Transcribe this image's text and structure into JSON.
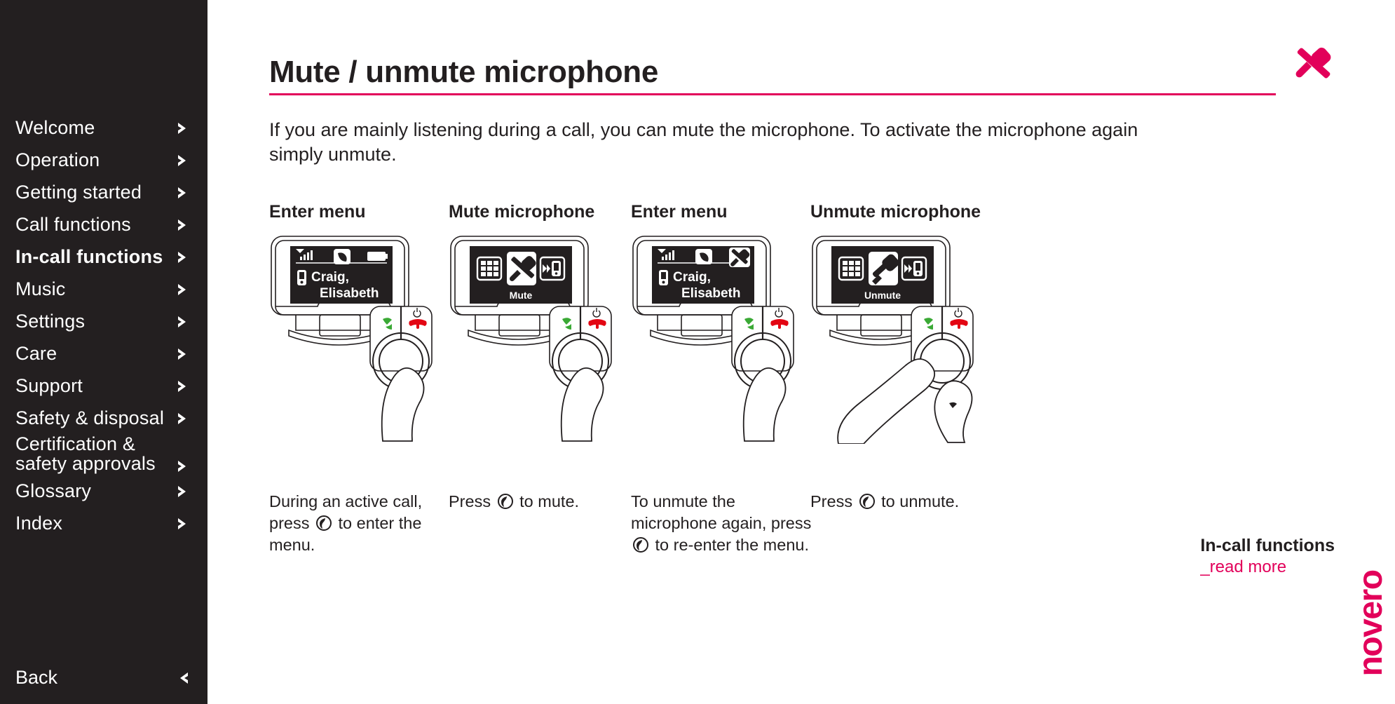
{
  "sidebar": {
    "items": [
      {
        "label": "Welcome",
        "active": false,
        "icon": "chevron-right-icon"
      },
      {
        "label": "Operation",
        "active": false,
        "icon": "chevron-right-icon"
      },
      {
        "label": "Getting started",
        "active": false,
        "icon": "chevron-right-icon"
      },
      {
        "label": "Call functions",
        "active": false,
        "icon": "chevron-right-icon"
      },
      {
        "label": "In-call functions",
        "active": true,
        "icon": "chevron-right-icon"
      },
      {
        "label": "Music",
        "active": false,
        "icon": "chevron-right-icon"
      },
      {
        "label": "Settings",
        "active": false,
        "icon": "chevron-right-icon"
      },
      {
        "label": "Care",
        "active": false,
        "icon": "chevron-right-icon"
      },
      {
        "label": "Support",
        "active": false,
        "icon": "chevron-right-icon"
      },
      {
        "label": "Safety & disposal",
        "active": false,
        "icon": "chevron-right-icon"
      },
      {
        "label": "Certification &\nsafety approvals",
        "active": false,
        "icon": "chevron-right-icon"
      },
      {
        "label": "Glossary",
        "active": false,
        "icon": "chevron-right-icon"
      },
      {
        "label": "Index",
        "active": false,
        "icon": "chevron-right-icon"
      }
    ],
    "back_label": "Back",
    "back_icon": "chevron-left-icon",
    "background_color": "#231f20"
  },
  "header": {
    "title": "Mute / unmute microphone",
    "rule_color": "#e2005a",
    "icon": "muted-microphone-icon",
    "icon_color": "#e2005a"
  },
  "intro": "If you are mainly listening during a call, you can mute the microphone. To activate the microphone again simply unmute.",
  "steps": [
    {
      "title": "Enter menu",
      "screen_type": "call-in-progress",
      "screen": {
        "signal_icon": "signal-bars-icon",
        "call_icon": "handset-icon",
        "status_right_icon": "battery-full-icon",
        "contact_icon": "mobile-phone-icon",
        "contact_line1": "Craig,",
        "contact_line2": "Elisabeth"
      },
      "caption_before": "During an active call, press",
      "caption_glyph": "nav-dial-button-icon",
      "caption_after": "to enter the menu."
    },
    {
      "title": "Mute microphone",
      "screen_type": "menu",
      "screen": {
        "left_icon": "keypad-icon",
        "center_icon": "muted-microphone-icon",
        "right_icon": "transfer-to-phone-icon",
        "menu_label": "Mute"
      },
      "caption_before": "Press",
      "caption_glyph": "nav-dial-button-icon",
      "caption_after": "to mute."
    },
    {
      "title": "Enter menu",
      "screen_type": "call-in-progress-muted",
      "screen": {
        "signal_icon": "signal-bars-icon",
        "call_icon": "handset-icon",
        "status_right_icon": "muted-microphone-icon",
        "contact_icon": "mobile-phone-icon",
        "contact_line1": "Craig,",
        "contact_line2": "Elisabeth"
      },
      "caption_before": "To unmute the microphone again, press",
      "caption_glyph": "nav-dial-button-icon",
      "caption_after": "to re-enter the menu."
    },
    {
      "title": "Unmute microphone",
      "screen_type": "menu",
      "screen": {
        "left_icon": "keypad-icon",
        "center_icon": "microphone-icon",
        "right_icon": "transfer-to-phone-icon",
        "menu_label": "Unmute"
      },
      "caption_before": "Press",
      "caption_glyph": "nav-dial-button-icon",
      "caption_after": "to unmute."
    }
  ],
  "device": {
    "accept_call_icon": "accept-call-icon",
    "accept_call_color": "#3aa935",
    "end_call_icon": "end-call-icon",
    "end_call_color": "#e30613",
    "power_icon": "power-icon"
  },
  "read_more": {
    "title": "In-call functions",
    "link": "_read more",
    "link_color": "#e2005a"
  },
  "logo": {
    "text": "novero",
    "color": "#e2005a"
  }
}
